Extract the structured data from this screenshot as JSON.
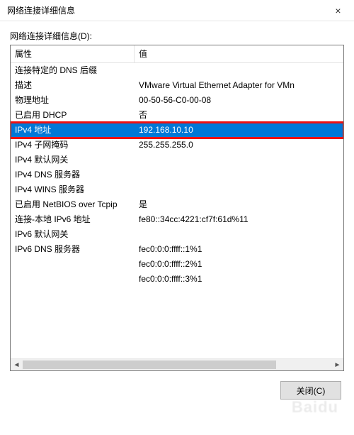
{
  "window": {
    "title": "网络连接详细信息",
    "close_button": "×"
  },
  "section_label": "网络连接详细信息(D):",
  "columns": {
    "property": "属性",
    "value": "值"
  },
  "rows": [
    {
      "prop": "连接特定的 DNS 后缀",
      "val": ""
    },
    {
      "prop": "描述",
      "val": "VMware Virtual Ethernet Adapter for VMn"
    },
    {
      "prop": "物理地址",
      "val": "00-50-56-C0-00-08"
    },
    {
      "prop": "已启用 DHCP",
      "val": "否"
    },
    {
      "prop": "IPv4 地址",
      "val": "192.168.10.10",
      "selected": true
    },
    {
      "prop": "IPv4 子网掩码",
      "val": "255.255.255.0"
    },
    {
      "prop": "IPv4 默认网关",
      "val": ""
    },
    {
      "prop": "IPv4 DNS 服务器",
      "val": ""
    },
    {
      "prop": "IPv4 WINS 服务器",
      "val": ""
    },
    {
      "prop": "已启用 NetBIOS over Tcpip",
      "val": "是"
    },
    {
      "prop": "连接-本地 IPv6 地址",
      "val": "fe80::34cc:4221:cf7f:61d%11"
    },
    {
      "prop": "IPv6 默认网关",
      "val": ""
    },
    {
      "prop": "IPv6 DNS 服务器",
      "val": "fec0:0:0:ffff::1%1"
    }
  ],
  "extra_values": [
    "fec0:0:0:ffff::2%1",
    "fec0:0:0:ffff::3%1"
  ],
  "close_text": "关闭(C)",
  "watermark": "Baidu"
}
